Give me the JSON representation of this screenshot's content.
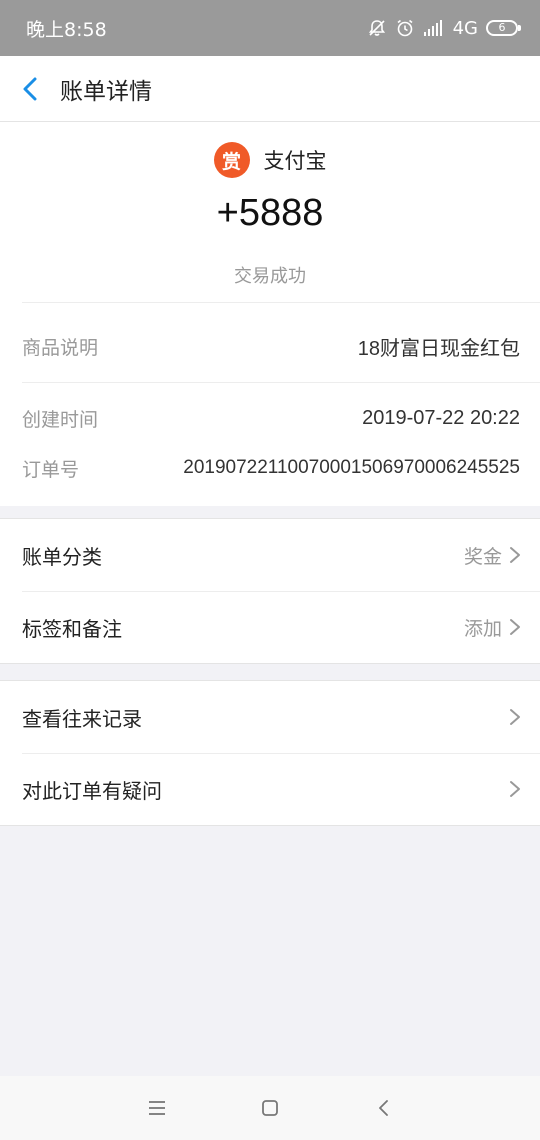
{
  "status_bar": {
    "time": "晚上8:58",
    "network": "4G",
    "battery": "6"
  },
  "header": {
    "title": "账单详情"
  },
  "bill": {
    "merchant_badge": "赏",
    "merchant_name": "支付宝",
    "amount": "+5888",
    "status": "交易成功",
    "details": [
      {
        "label": "商品说明",
        "value": "18财富日现金红包"
      },
      {
        "label": "创建时间",
        "value": "2019-07-22 20:22"
      },
      {
        "label": "订单号",
        "value": "2019072211007000150697000624 5525"
      }
    ]
  },
  "menu_group_1": [
    {
      "label": "账单分类",
      "value": "奖金"
    },
    {
      "label": "标签和备注",
      "value": "添加"
    }
  ],
  "menu_group_2": [
    {
      "label": "查看往来记录",
      "value": ""
    },
    {
      "label": "对此订单有疑问",
      "value": ""
    }
  ],
  "colors": {
    "accent": "#1a8ee6",
    "badge": "#f05a28",
    "status_bar": "#9a9a9a"
  }
}
